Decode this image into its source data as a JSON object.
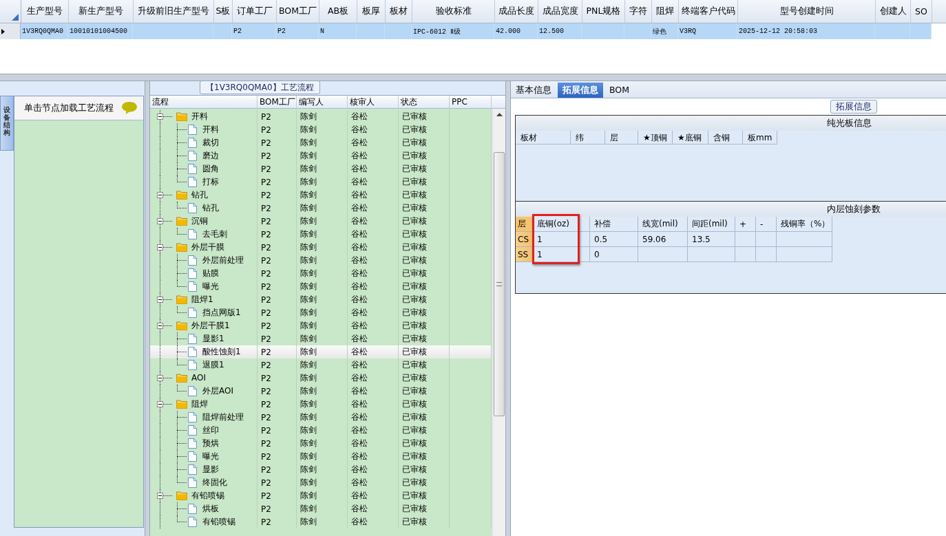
{
  "product_grid": {
    "columns": [
      "生产型号",
      "新生产型号",
      "升级前旧生产型号",
      "S板",
      "订单工厂",
      "BOM工厂",
      "AB板",
      "板厚",
      "板材",
      "验收标准",
      "成品长度",
      "成品宽度",
      "PNL规格",
      "字符",
      "阻焊",
      "终端客户代码",
      "型号创建时间",
      "创建人",
      "SO"
    ],
    "rows": [
      {
        "selected": true,
        "cells": [
          "1V3RQ0QMA0",
          "10010101004500",
          "",
          "",
          "P2",
          "P2",
          "N",
          "",
          "",
          "IPC-6012 Ⅱ级",
          "42.000",
          "12.500",
          "",
          "",
          "绿色",
          "V3RQ",
          "2025-12-12 20:58:03",
          "",
          ""
        ]
      }
    ]
  },
  "side_tab": {
    "label": "设备结构"
  },
  "node_panel": {
    "hint": "单击节点加载工艺流程"
  },
  "process_flow": {
    "title": "【1V3RQ0QMA0】工艺流程",
    "columns": [
      "流程",
      "BOM工厂",
      "编写人",
      "核审人",
      "状态",
      "PPC"
    ],
    "rows": [
      {
        "name": "开料",
        "bom": "P2",
        "writer": "陈剑",
        "reviewer": "谷松",
        "status": "已审核",
        "selected": false,
        "expanded": true,
        "children": [
          {
            "name": "开料",
            "bom": "P2",
            "writer": "陈剑",
            "reviewer": "谷松",
            "status": "已审核",
            "selected": false
          },
          {
            "name": "裁切",
            "bom": "P2",
            "writer": "陈剑",
            "reviewer": "谷松",
            "status": "已审核",
            "selected": false
          },
          {
            "name": "磨边",
            "bom": "P2",
            "writer": "陈剑",
            "reviewer": "谷松",
            "status": "已审核",
            "selected": false
          },
          {
            "name": "圆角",
            "bom": "P2",
            "writer": "陈剑",
            "reviewer": "谷松",
            "status": "已审核",
            "selected": false
          },
          {
            "name": "打标",
            "bom": "P2",
            "writer": "陈剑",
            "reviewer": "谷松",
            "status": "已审核",
            "selected": false
          }
        ]
      },
      {
        "name": "钻孔",
        "bom": "P2",
        "writer": "陈剑",
        "reviewer": "谷松",
        "status": "已审核",
        "selected": false,
        "expanded": true,
        "children": [
          {
            "name": "钻孔",
            "bom": "P2",
            "writer": "陈剑",
            "reviewer": "谷松",
            "status": "已审核",
            "selected": false
          }
        ]
      },
      {
        "name": "沉铜",
        "bom": "P2",
        "writer": "陈剑",
        "reviewer": "谷松",
        "status": "已审核",
        "selected": false,
        "expanded": true,
        "children": [
          {
            "name": "去毛刺",
            "bom": "P2",
            "writer": "陈剑",
            "reviewer": "谷松",
            "status": "已审核",
            "selected": false
          }
        ]
      },
      {
        "name": "外层干膜",
        "bom": "P2",
        "writer": "陈剑",
        "reviewer": "谷松",
        "status": "已审核",
        "selected": false,
        "expanded": true,
        "children": [
          {
            "name": "外层前处理",
            "bom": "P2",
            "writer": "陈剑",
            "reviewer": "谷松",
            "status": "已审核",
            "selected": false
          },
          {
            "name": "贴膜",
            "bom": "P2",
            "writer": "陈剑",
            "reviewer": "谷松",
            "status": "已审核",
            "selected": false
          },
          {
            "name": "曝光",
            "bom": "P2",
            "writer": "陈剑",
            "reviewer": "谷松",
            "status": "已审核",
            "selected": false
          }
        ]
      },
      {
        "name": "阻焊1",
        "bom": "P2",
        "writer": "陈剑",
        "reviewer": "谷松",
        "status": "已审核",
        "selected": false,
        "expanded": true,
        "children": [
          {
            "name": "挡点网版1",
            "bom": "P2",
            "writer": "陈剑",
            "reviewer": "谷松",
            "status": "已审核",
            "selected": false
          }
        ]
      },
      {
        "name": "外层干膜1",
        "bom": "P2",
        "writer": "陈剑",
        "reviewer": "谷松",
        "status": "已审核",
        "selected": false,
        "expanded": true,
        "children": [
          {
            "name": "显影1",
            "bom": "P2",
            "writer": "陈剑",
            "reviewer": "谷松",
            "status": "已审核",
            "selected": false
          },
          {
            "name": "酸性蚀刻1",
            "bom": "P2",
            "writer": "陈剑",
            "reviewer": "谷松",
            "status": "已审核",
            "selected": true
          },
          {
            "name": "退膜1",
            "bom": "P2",
            "writer": "陈剑",
            "reviewer": "谷松",
            "status": "已审核",
            "selected": false
          }
        ]
      },
      {
        "name": "AOI",
        "bom": "P2",
        "writer": "陈剑",
        "reviewer": "谷松",
        "status": "已审核",
        "selected": false,
        "expanded": true,
        "children": [
          {
            "name": "外层AOI",
            "bom": "P2",
            "writer": "陈剑",
            "reviewer": "谷松",
            "status": "已审核",
            "selected": false
          }
        ]
      },
      {
        "name": "阻焊",
        "bom": "P2",
        "writer": "陈剑",
        "reviewer": "谷松",
        "status": "已审核",
        "selected": false,
        "expanded": true,
        "children": [
          {
            "name": "阻焊前处理",
            "bom": "P2",
            "writer": "陈剑",
            "reviewer": "谷松",
            "status": "已审核",
            "selected": false
          },
          {
            "name": "丝印",
            "bom": "P2",
            "writer": "陈剑",
            "reviewer": "谷松",
            "status": "已审核",
            "selected": false
          },
          {
            "name": "预烘",
            "bom": "P2",
            "writer": "陈剑",
            "reviewer": "谷松",
            "status": "已审核",
            "selected": false
          },
          {
            "name": "曝光",
            "bom": "P2",
            "writer": "陈剑",
            "reviewer": "谷松",
            "status": "已审核",
            "selected": false
          },
          {
            "name": "显影",
            "bom": "P2",
            "writer": "陈剑",
            "reviewer": "谷松",
            "status": "已审核",
            "selected": false
          },
          {
            "name": "终固化",
            "bom": "P2",
            "writer": "陈剑",
            "reviewer": "谷松",
            "status": "已审核",
            "selected": false
          }
        ]
      },
      {
        "name": "有铅喷锡",
        "bom": "P2",
        "writer": "陈剑",
        "reviewer": "谷松",
        "status": "已审核",
        "selected": false,
        "expanded": true,
        "children": [
          {
            "name": "烘板",
            "bom": "P2",
            "writer": "陈剑",
            "reviewer": "谷松",
            "status": "已审核",
            "selected": false
          },
          {
            "name": "有铅喷锡",
            "bom": "P2",
            "writer": "陈剑",
            "reviewer": "谷松",
            "status": "已审核",
            "selected": false
          }
        ]
      }
    ]
  },
  "detail_tabs": [
    {
      "label": "基本信息",
      "selected": false
    },
    {
      "label": "拓展信息",
      "selected": true
    },
    {
      "label": "BOM",
      "selected": false
    }
  ],
  "extended_info": {
    "title": "拓展信息",
    "bare_board": {
      "title": "纯光板信息",
      "columns": [
        "板材",
        "纬",
        "层",
        "★顶铜",
        "★底铜",
        "含铜",
        "板mm"
      ]
    },
    "inner_etch": {
      "title": "内层蚀刻参数",
      "columns": [
        {
          "label": "层",
          "highlighted": false
        },
        {
          "label": "底铜(oz)",
          "highlighted": true
        },
        {
          "label": "补偿",
          "highlighted": false
        },
        {
          "label": "线宽(mil)",
          "highlighted": false
        },
        {
          "label": "间距(mil)",
          "highlighted": false
        },
        {
          "label": "+",
          "highlighted": false
        },
        {
          "label": "-",
          "highlighted": false
        },
        {
          "label": "残铜率（%）",
          "highlighted": false
        }
      ],
      "rows": [
        [
          "CS",
          "1",
          "0.5",
          "59.06",
          "13.5",
          "",
          "",
          ""
        ],
        [
          "SS",
          "1",
          "0",
          "",
          "",
          "",
          "",
          ""
        ]
      ]
    }
  }
}
